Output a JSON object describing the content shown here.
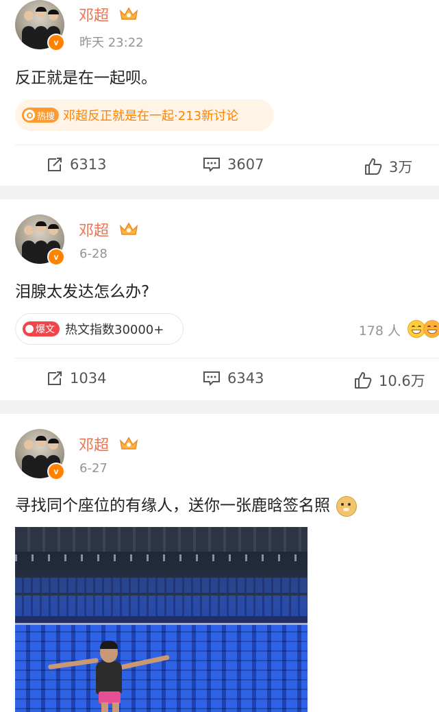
{
  "colors": {
    "name": "#eb7350",
    "verified": "#ff8200",
    "hot": "#ff8200",
    "bao": "#f0464a",
    "muted": "#939393"
  },
  "posts": [
    {
      "username": "邓超",
      "time": "昨天 23:22",
      "content": "反正就是在一起呗。",
      "hot_tag": {
        "icon": "fire-search-icon",
        "label": "热搜",
        "text": "邓超反正就是在一起·213新讨论"
      },
      "actions": {
        "repost": "6313",
        "comment": "3607",
        "like": "3万"
      }
    },
    {
      "username": "邓超",
      "time": "6-28",
      "content": "泪腺太发达怎么办?",
      "bao_tag": {
        "label": "爆文",
        "text": "热文指数30000+"
      },
      "reaction_people": "178 人",
      "reaction_icons": [
        "grin-emoji-icon",
        "laugh-tears-emoji-icon"
      ],
      "actions": {
        "repost": "1034",
        "comment": "6343",
        "like": "10.6万"
      }
    },
    {
      "username": "邓超",
      "time": "6-27",
      "content": "寻找同个座位的有缘人，送你一张鹿晗签名照",
      "content_emoji": "doge-emoji-icon",
      "image": "stadium-blue-seats-photo"
    }
  ]
}
